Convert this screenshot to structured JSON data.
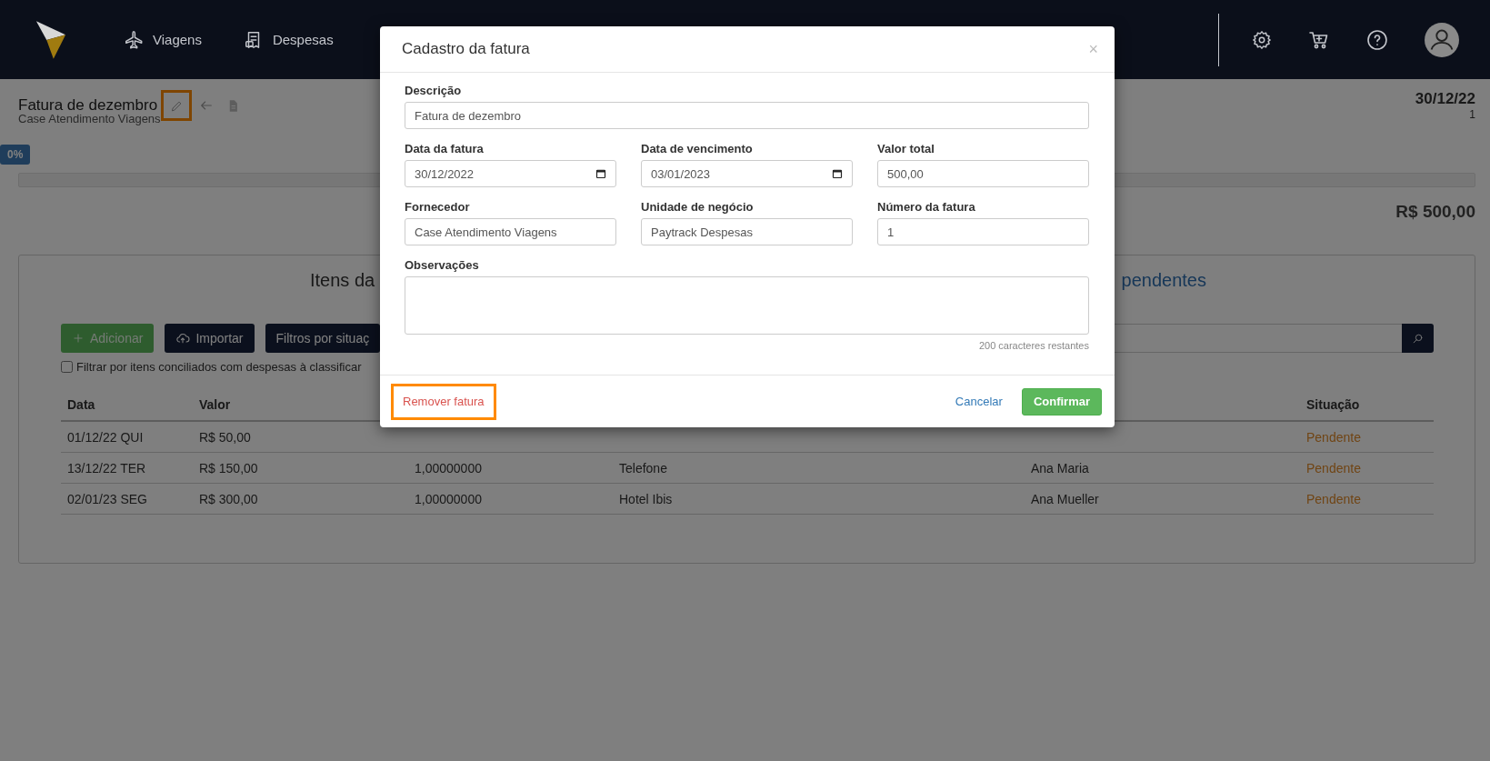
{
  "header": {
    "nav": [
      {
        "label": "Viagens",
        "kind": "plane"
      },
      {
        "label": "Despesas",
        "kind": "receipt"
      }
    ],
    "actions": [
      {
        "kind": "settings"
      },
      {
        "kind": "cart"
      },
      {
        "kind": "help"
      },
      {
        "kind": "avatar"
      }
    ]
  },
  "invoice": {
    "title": "Fatura de dezembro",
    "subtitle": "Case Atendimento Viagens",
    "edit_highlighted": true,
    "date": "30/12/22",
    "number": "1",
    "progress_label": "0%",
    "level": 0,
    "total": "R$ 500,00"
  },
  "items_panel": {
    "heading_left": "Itens da",
    "heading_right": "pendentes",
    "buttons": [
      {
        "label": "Adicionar",
        "kind": "add"
      },
      {
        "label": "Importar",
        "kind": "import"
      },
      {
        "label": "Filtros por situaç",
        "kind": "filter"
      }
    ],
    "filter_checkbox": {
      "label": "Filtrar por itens conciliados com despesas à classificar",
      "checked": false
    },
    "table": {
      "header": {
        "data": "Data",
        "valor": "Valor",
        "situacao": "Situação"
      },
      "rows": [
        {
          "data": "01/12/22 QUI",
          "valor": "R$ 50,00",
          "situacao": "Pendente"
        },
        {
          "data": "13/12/22 TER",
          "valor": "R$ 150,00",
          "column_3": "1,00000000",
          "column_4": "Telefone",
          "column_5": "Ana Maria",
          "situacao": "Pendente"
        },
        {
          "data": "02/01/23 SEG",
          "valor": "R$ 300,00",
          "column_3": "1,00000000",
          "column_4": "Hotel Ibis",
          "column_5": "Ana Mueller",
          "situacao": "Pendente"
        }
      ]
    }
  },
  "modal": {
    "title": "Cadastro da fatura",
    "close": "×",
    "fields": [
      {
        "label": "Descrição",
        "value": "Fatura de dezembro",
        "kind": "wide"
      },
      {
        "label": "Data da fatura",
        "value": "30/12/2022",
        "kind": "date"
      },
      {
        "label": "Data de vencimento",
        "value": "03/01/2023",
        "kind": "date"
      },
      {
        "label": "Valor total",
        "value": "500,00",
        "kind": "text"
      },
      {
        "label": "Fornecedor",
        "value": "Case Atendimento Viagens",
        "kind": "text"
      },
      {
        "label": "Unidade de negócio",
        "value": "Paytrack Despesas",
        "kind": "text"
      },
      {
        "label": "Número da fatura",
        "value": "1",
        "kind": "text"
      },
      {
        "label": "Observações",
        "kind": "textarea"
      }
    ],
    "counter": "200 caracteres restantes",
    "remove": {
      "label": "Remover fatura",
      "highlighted": true
    },
    "cancel": "Cancelar",
    "confirm": "Confirmar"
  }
}
